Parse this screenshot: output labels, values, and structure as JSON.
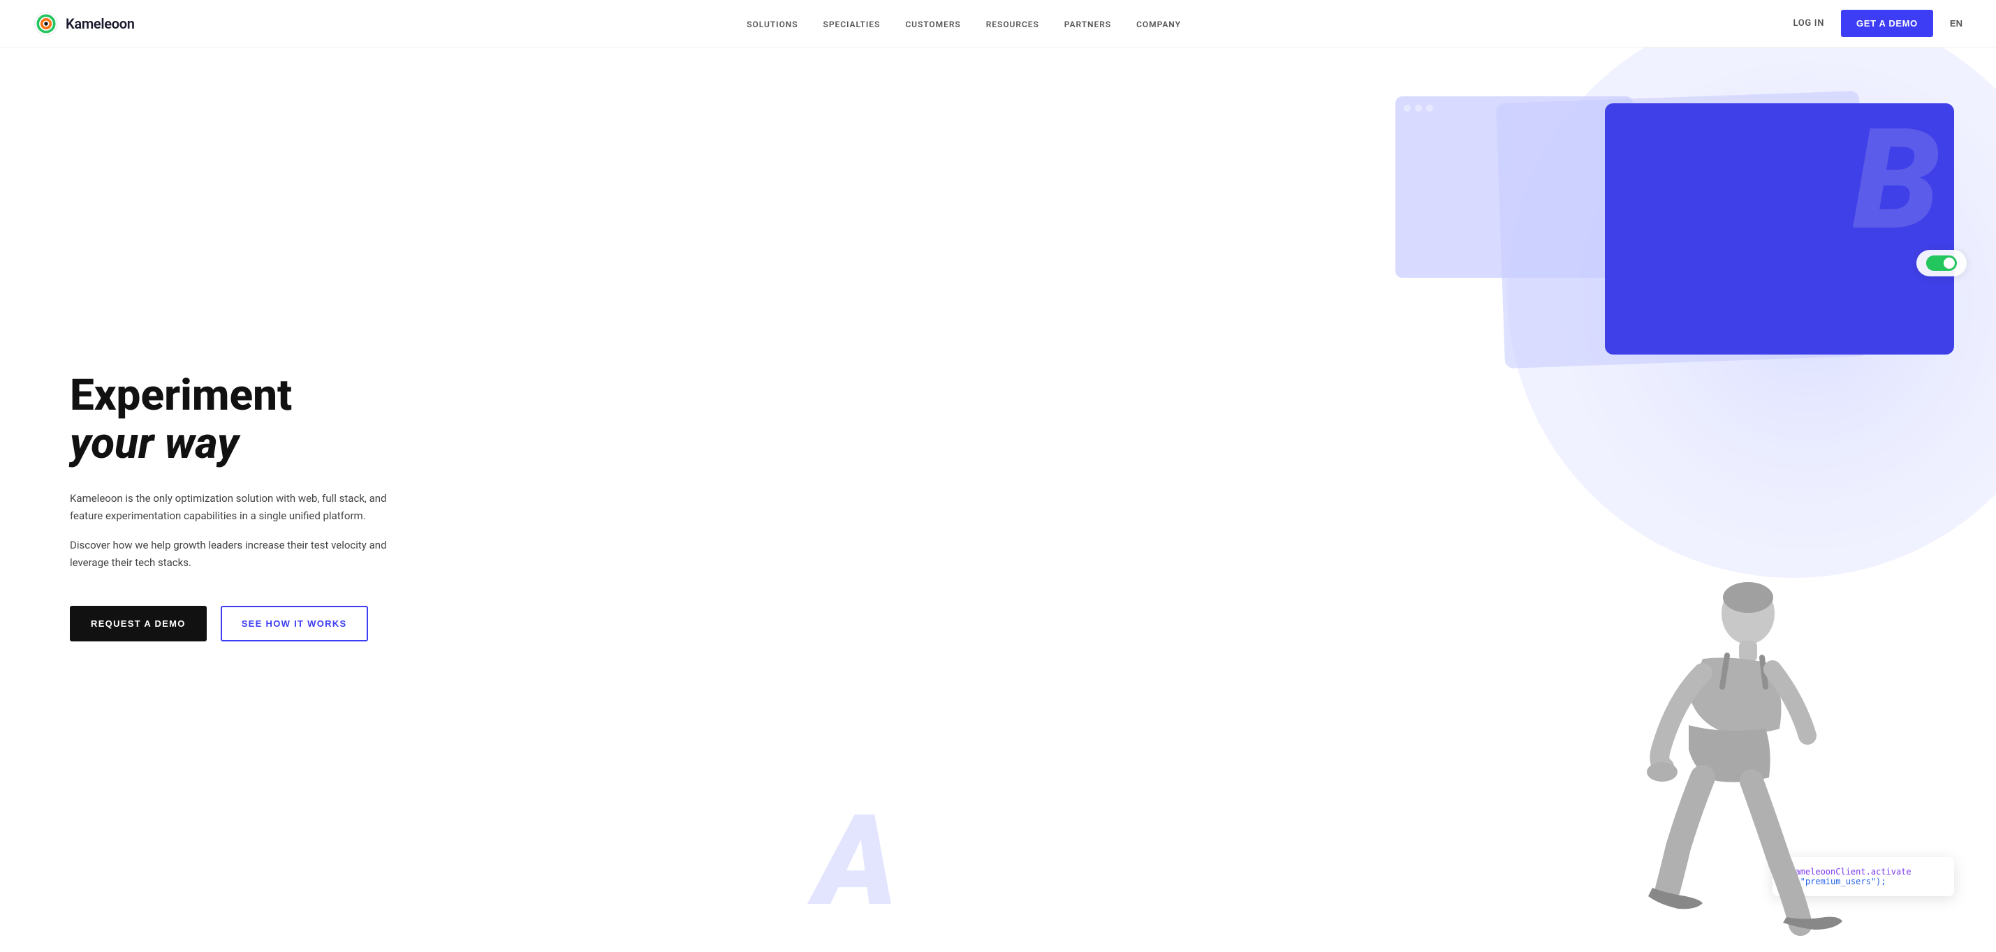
{
  "brand": {
    "logo_text": "Kameleoon",
    "logo_icon_alt": "Kameleoon logo"
  },
  "nav": {
    "links": [
      {
        "label": "SOLUTIONS",
        "id": "solutions"
      },
      {
        "label": "SPECIALTIES",
        "id": "specialties"
      },
      {
        "label": "CUSTOMERS",
        "id": "customers"
      },
      {
        "label": "RESOURCES",
        "id": "resources"
      },
      {
        "label": "PARTNERS",
        "id": "partners"
      },
      {
        "label": "COMPANY",
        "id": "company"
      }
    ],
    "login_label": "LOG IN",
    "demo_label": "GET A DEMO",
    "lang_label": "EN"
  },
  "hero": {
    "title_line1": "Experiment",
    "title_line2": "your way",
    "subtitle1": "Kameleoon is the only optimization solution with web, full stack, and feature experimentation capabilities in a single unified platform.",
    "subtitle2": "Discover how we help growth leaders increase their test velocity and leverage their tech stacks.",
    "cta_primary": "REQUEST A DEMO",
    "cta_secondary": "SEE HOW IT WORKS"
  },
  "visual": {
    "letter_a": "A",
    "letter_b": "B",
    "toggle_on_label": "ON",
    "code_snippet_line1": "\"kameleoonClient.activate",
    "code_snippet_line2": "B\",\"premium_users\");"
  }
}
